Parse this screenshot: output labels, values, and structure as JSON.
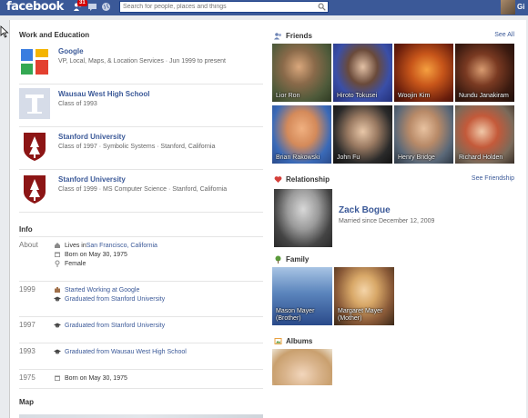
{
  "topbar": {
    "logo": "facebook",
    "notifications_count": "31",
    "search_placeholder": "Search for people, places and things",
    "user_name": "Gi"
  },
  "work_education": {
    "title": "Work and Education",
    "items": [
      {
        "name": "Google",
        "detail": "VP, Local, Maps, & Location Services · Jun 1999 to present"
      },
      {
        "name": "Wausau West High School",
        "detail": "Class of 1993"
      },
      {
        "name": "Stanford University",
        "detail": "Class of 1997 · Symbolic Systems · Stanford, California"
      },
      {
        "name": "Stanford University",
        "detail": "Class of 1999 · MS Computer Science · Stanford, California"
      }
    ]
  },
  "info": {
    "title": "Info",
    "about_label": "About",
    "lives_prefix": "Lives in ",
    "lives_link": "San Francisco, California",
    "born": "Born on May 30, 1975",
    "gender": "Female",
    "timeline": [
      {
        "year": "1999",
        "events": [
          "Started Working at Google",
          "Graduated from Stanford University"
        ]
      },
      {
        "year": "1997",
        "events": [
          "Graduated from Stanford University"
        ]
      },
      {
        "year": "1993",
        "events": [
          "Graduated from Wausau West High School"
        ]
      },
      {
        "year": "1975",
        "events": [
          "Born on May 30, 1975"
        ]
      }
    ]
  },
  "map": {
    "title": "Map"
  },
  "friends": {
    "title": "Friends",
    "see_all": "See All",
    "items": [
      {
        "name": "Lior Ron"
      },
      {
        "name": "Hiroto Tokusei"
      },
      {
        "name": "Woojin Kim"
      },
      {
        "name": "Nundu Janakiram"
      },
      {
        "name": "Brian Rakowski"
      },
      {
        "name": "John Fu"
      },
      {
        "name": "Henry Bridge"
      },
      {
        "name": "Richard Holden"
      }
    ]
  },
  "relationship": {
    "title": "Relationship",
    "link": "See Friendship",
    "name": "Zack Bogue",
    "detail": "Married since December 12, 2009"
  },
  "family": {
    "title": "Family",
    "members": [
      {
        "name": "Mason Mayer",
        "relation": "(Brother)"
      },
      {
        "name": "Margaret Mayer",
        "relation": "(Mother)"
      }
    ]
  },
  "albums": {
    "title": "Albums"
  }
}
